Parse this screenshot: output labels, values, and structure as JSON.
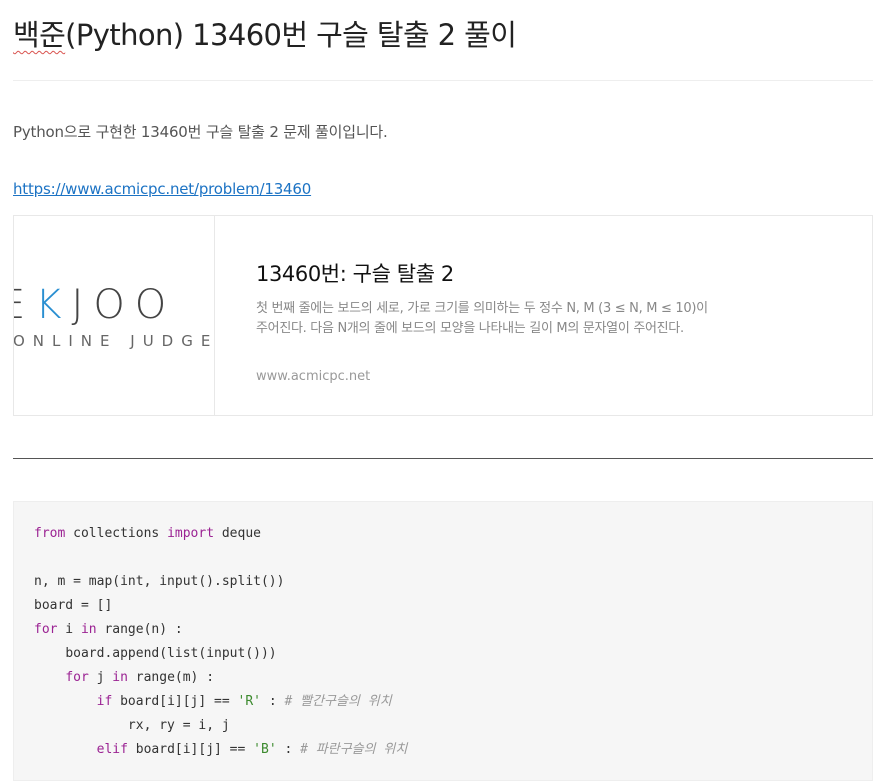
{
  "post": {
    "title_prefix": "백준",
    "title_rest": "(Python) 13460번 구슬 탈출 2 풀이",
    "intro": "Python으로 구현한 13460번 구슬 탈출 2 문제 풀이입니다.",
    "link": "https://www.acmicpc.net/problem/13460"
  },
  "card": {
    "logo_left": "E",
    "logo_k": "K",
    "logo_right": "JOO",
    "logo_sub": "ONLINE JUDGE",
    "title": "13460번: 구슬 탈출 2",
    "description": "첫 번째 줄에는 보드의 세로, 가로 크기를 의미하는 두 정수 N, M (3 ≤ N, M ≤ 10)이 주어진다. 다음 N개의 줄에 보드의 모양을 나타내는 길이 M의 문자열이 주어진다.",
    "domain": "www.acmicpc.net"
  },
  "code": {
    "kw_from": "from",
    "kw_import": "import",
    "kw_for": "for",
    "kw_in": "in",
    "kw_if": "if",
    "kw_elif": "elif",
    "l1_mid": " collections ",
    "l1_end": " deque",
    "l3": "n, m = map(int, input().split())",
    "l4": "board = []",
    "l5_mid": " i ",
    "l5_end": " range(n) :",
    "l6": "board.append(list(input()))",
    "l7_mid": " j ",
    "l7_end": " range(m) :",
    "l8_mid": " board[i][j] == ",
    "l8_str": "'R'",
    "l8_colon": " : ",
    "l8_cm": "# 빨간구슬의 위치",
    "l9": "rx, ry = i, j",
    "l10_mid": " board[i][j] == ",
    "l10_str": "'B'",
    "l10_colon": " : ",
    "l10_cm": "# 파란구슬의 위치"
  }
}
